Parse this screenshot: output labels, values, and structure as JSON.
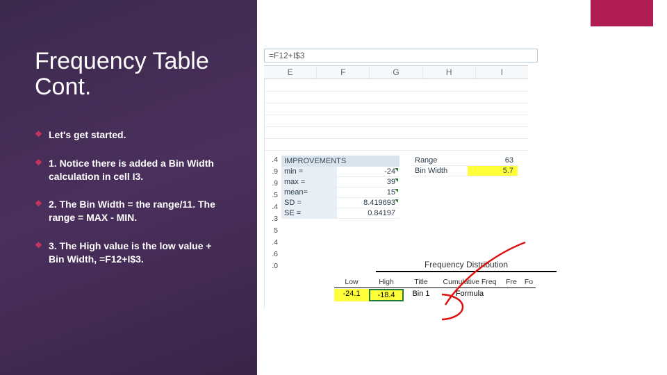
{
  "slide": {
    "title": "Frequency Table Cont.",
    "bullets": [
      "Let's get started.",
      "1. Notice there is added a Bin Width calculation in cell I3.",
      "2.  The Bin Width = the range/11. The range = MAX - MIN.",
      "3. The High value is the low value + Bin Width, =F12+I$3."
    ]
  },
  "sheet": {
    "formula_bar": "=F12+I$3",
    "columns": [
      "E",
      "F",
      "G",
      "H",
      "I"
    ],
    "partial_left": [
      ".4",
      ".9",
      ".9",
      ".5",
      ".4",
      ".3",
      "5",
      ".4",
      ".6",
      ".0"
    ],
    "stats": {
      "header": "IMPROVEMENTS",
      "rows": [
        {
          "label": "min =",
          "value": "-24"
        },
        {
          "label": "max =",
          "value": "39"
        },
        {
          "label": "mean=",
          "value": "15"
        },
        {
          "label": "SD =",
          "value": "8.419693"
        },
        {
          "label": "SE =",
          "value": "0.84197"
        }
      ]
    },
    "range": {
      "rows": [
        {
          "label": "Range",
          "value": "63"
        },
        {
          "label": "Bin Width",
          "value": "5.7"
        }
      ]
    },
    "fd": {
      "title": "Frequency Distribution",
      "headers": [
        "Low",
        "High",
        "Title",
        "Cumulative Freq",
        "Fre",
        "Fo"
      ],
      "row": {
        "low": "-24.1",
        "high": "-18.4",
        "title": "Bin 1",
        "cum": "Formula",
        "freq": "",
        "fo": ""
      }
    }
  }
}
